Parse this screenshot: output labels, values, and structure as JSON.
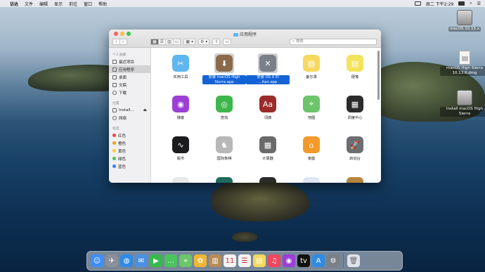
{
  "menubar": {
    "apple": "",
    "items": [
      "访达",
      "文件",
      "编辑",
      "显示",
      "前往",
      "窗口",
      "帮助"
    ],
    "clock": "周二 下午2:29"
  },
  "desktop": {
    "icons": [
      {
        "label": "macOS 10.15.x",
        "kind": "drive"
      },
      {
        "label": "macOS High Sierra 10.13.6.dmg",
        "kind": "document"
      },
      {
        "label": "Install macOS High Sierra",
        "kind": "drive"
      }
    ]
  },
  "finder": {
    "title": "应用程序",
    "toolbar": {
      "back": "‹",
      "forward": "›",
      "view_modes": [
        "▦",
        "☰",
        "▥",
        "▭"
      ],
      "group": "▦ ▾",
      "action": "⚙ ▾",
      "share": "⇧",
      "tag": "▭",
      "search_placeholder": "搜索"
    },
    "sidebar": {
      "sections": [
        {
          "heading": "个人收藏",
          "items": [
            {
              "label": "最近项目",
              "selected": false
            },
            {
              "label": "应用程序",
              "selected": true
            },
            {
              "label": "桌面",
              "selected": false
            },
            {
              "label": "文稿",
              "selected": false
            },
            {
              "label": "下载",
              "selected": false
            }
          ]
        },
        {
          "heading": "位置",
          "items": [
            {
              "label": "Install...",
              "selected": false
            },
            {
              "label": "网络",
              "selected": false
            }
          ]
        }
      ],
      "tags_heading": "标签",
      "tags": [
        {
          "label": "红色",
          "color": "#f0443a"
        },
        {
          "label": "橙色",
          "color": "#f59a23"
        },
        {
          "label": "黄色",
          "color": "#f7d02c"
        },
        {
          "label": "绿色",
          "color": "#4cc152"
        },
        {
          "label": "蓝色",
          "color": "#3a82f7"
        }
      ]
    },
    "apps": [
      {
        "name": "实用工具",
        "icon": "folder-icon",
        "color": "#5fb6f0",
        "glyph": "✂",
        "selected": false
      },
      {
        "name": "安装 macOS High Sierra.app",
        "icon": "installer-icon",
        "color": "#8a6a4a",
        "glyph": "⬇",
        "selected": true
      },
      {
        "name": "安装 OS X El ...itan.app",
        "icon": "installer-icon",
        "color": "#7a7f8a",
        "glyph": "✕",
        "selected": true
      },
      {
        "name": "备忘录",
        "icon": "notes-icon",
        "color": "#f6d95e",
        "glyph": "▤",
        "selected": false
      },
      {
        "name": "便笺",
        "icon": "stickies-icon",
        "color": "#f3e35c",
        "glyph": "▤",
        "selected": false
      },
      {
        "name": "播客",
        "icon": "podcasts-icon",
        "color": "#9b3fd6",
        "glyph": "◉",
        "selected": false
      },
      {
        "name": "查找",
        "icon": "find-my-icon",
        "color": "#3eb64a",
        "glyph": "◎",
        "selected": false
      },
      {
        "name": "词典",
        "icon": "dictionary-icon",
        "color": "#9b2a2a",
        "glyph": "Aa",
        "selected": false
      },
      {
        "name": "地图",
        "icon": "maps-icon",
        "color": "#6cc56a",
        "glyph": "⌖",
        "selected": false
      },
      {
        "name": "调度中心",
        "icon": "mission-control-icon",
        "color": "#2b2b2b",
        "glyph": "▦",
        "selected": false
      },
      {
        "name": "股市",
        "icon": "stocks-icon",
        "color": "#1c1c1e",
        "glyph": "∿",
        "selected": false
      },
      {
        "name": "国际象棋",
        "icon": "chess-icon",
        "color": "#b8b8b8",
        "glyph": "♞",
        "selected": false
      },
      {
        "name": "计算器",
        "icon": "calculator-icon",
        "color": "#6a6a6a",
        "glyph": "▦",
        "selected": false
      },
      {
        "name": "家庭",
        "icon": "home-icon",
        "color": "#f39a2a",
        "glyph": "⌂",
        "selected": false
      },
      {
        "name": "启动台",
        "icon": "launchpad-icon",
        "color": "#6d6e72",
        "glyph": "🚀",
        "selected": false
      },
      {
        "name": "",
        "icon": "calendar-icon",
        "color": "#e8e8e8",
        "glyph": "",
        "selected": false
      },
      {
        "name": "",
        "icon": "app-icon",
        "color": "#1f6b5a",
        "glyph": "",
        "selected": false
      },
      {
        "name": "",
        "icon": "app-icon",
        "color": "#2b2b2b",
        "glyph": "",
        "selected": false
      },
      {
        "name": "",
        "icon": "app-icon",
        "color": "#dfe6f2",
        "glyph": "",
        "selected": false
      },
      {
        "name": "",
        "icon": "app-icon",
        "color": "#b8833d",
        "glyph": "",
        "selected": false
      }
    ]
  },
  "dock": {
    "items": [
      {
        "icon": "finder-icon",
        "color": "#3e8ef7",
        "glyph": "☺"
      },
      {
        "icon": "launchpad-icon",
        "color": "#8a8f99",
        "glyph": "✈"
      },
      {
        "icon": "safari-icon",
        "color": "#2f8be6",
        "glyph": "◍"
      },
      {
        "icon": "mail-icon",
        "color": "#4a90e2",
        "glyph": "✉"
      },
      {
        "icon": "facetime-icon",
        "color": "#38b94d",
        "glyph": "▶"
      },
      {
        "icon": "messages-icon",
        "color": "#4bc45d",
        "glyph": "…"
      },
      {
        "icon": "maps-icon",
        "color": "#6cc56a",
        "glyph": "⌖"
      },
      {
        "icon": "photos-icon",
        "color": "#f2b632",
        "glyph": "✿"
      },
      {
        "icon": "contacts-icon",
        "color": "#b88b57",
        "glyph": "▥"
      },
      {
        "icon": "calendar-icon",
        "color": "#f3f3f3",
        "glyph": "11"
      },
      {
        "icon": "reminders-icon",
        "color": "#f3f3f3",
        "glyph": "☰"
      },
      {
        "icon": "notes-icon",
        "color": "#f6d95e",
        "glyph": "▤"
      },
      {
        "icon": "music-icon",
        "color": "#f0465e",
        "glyph": "♫"
      },
      {
        "icon": "podcasts-icon",
        "color": "#9b3fd6",
        "glyph": "◉"
      },
      {
        "icon": "tv-icon",
        "color": "#111111",
        "glyph": "tv"
      },
      {
        "icon": "app-store-icon",
        "color": "#2f8be6",
        "glyph": "A"
      },
      {
        "icon": "system-preferences-icon",
        "color": "#7b7f86",
        "glyph": "⚙"
      }
    ],
    "trash": {
      "icon": "trash-icon",
      "color": "#dfe3ea",
      "glyph": "🗑"
    }
  }
}
